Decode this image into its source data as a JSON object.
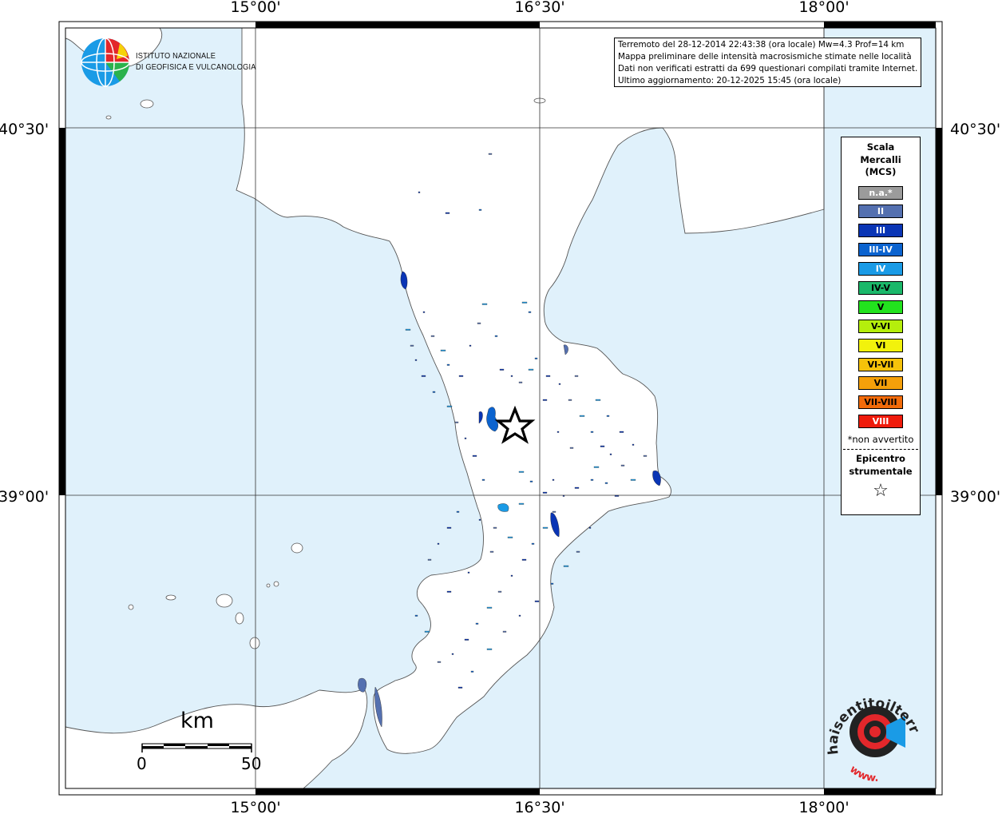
{
  "info": {
    "lines": [
      "Terremoto del 28-12-2014 22:43:38 (ora locale) Mw=4.3 Prof=14 km",
      "Mappa preliminare delle intensità macrosismiche stimate nelle località",
      "Dati non verificati estratti da 699 questionari compilati tramite Internet.",
      "Ultimo aggiornamento: 20-12-2025 15:45 (ora locale)"
    ]
  },
  "axes": {
    "longitudes": [
      "15°00'",
      "16°30'",
      "18°00'"
    ],
    "latitudes": [
      "40°30'",
      "39°00'"
    ]
  },
  "logo": {
    "line1": "ISTITUTO NAZIONALE",
    "line2": "DI GEOFISICA E VULCANOLOGIA"
  },
  "legend": {
    "title_lines": [
      "Scala",
      "Mercalli",
      "(MCS)"
    ],
    "items": [
      {
        "label": "n.a.*",
        "color": "#9b9b9b",
        "text_color": "#ffffff"
      },
      {
        "label": "II",
        "color": "#5470b0",
        "text_color": "#ffffff"
      },
      {
        "label": "III",
        "color": "#0a35b5",
        "text_color": "#ffffff"
      },
      {
        "label": "III-IV",
        "color": "#0b63cf",
        "text_color": "#ffffff"
      },
      {
        "label": "IV",
        "color": "#1a9be6",
        "text_color": "#ffffff"
      },
      {
        "label": "IV-V",
        "color": "#1bb86a",
        "text_color": "#000000"
      },
      {
        "label": "V",
        "color": "#22e21e",
        "text_color": "#000000"
      },
      {
        "label": "V-VI",
        "color": "#b5ee0c",
        "text_color": "#000000"
      },
      {
        "label": "VI",
        "color": "#f2f20c",
        "text_color": "#000000"
      },
      {
        "label": "VI-VII",
        "color": "#f5c20a",
        "text_color": "#000000"
      },
      {
        "label": "VII",
        "color": "#f5a00a",
        "text_color": "#000000"
      },
      {
        "label": "VII-VIII",
        "color": "#f26b0a",
        "text_color": "#000000"
      },
      {
        "label": "VIII",
        "color": "#ef1b0b",
        "text_color": "#ffffff"
      }
    ],
    "note": "*non avvertito",
    "epicenter_lines": [
      "Epicentro",
      "strumentale"
    ],
    "epicenter_symbol": "☆"
  },
  "scalebar": {
    "unit": "km",
    "min": "0",
    "max": "50"
  },
  "hsit_logo": {
    "text": "haisentitoilterremoto.it",
    "www": "www."
  },
  "colors": {
    "sea": "#e0f1fb",
    "land": "#ffffff",
    "grid": "#333333"
  }
}
